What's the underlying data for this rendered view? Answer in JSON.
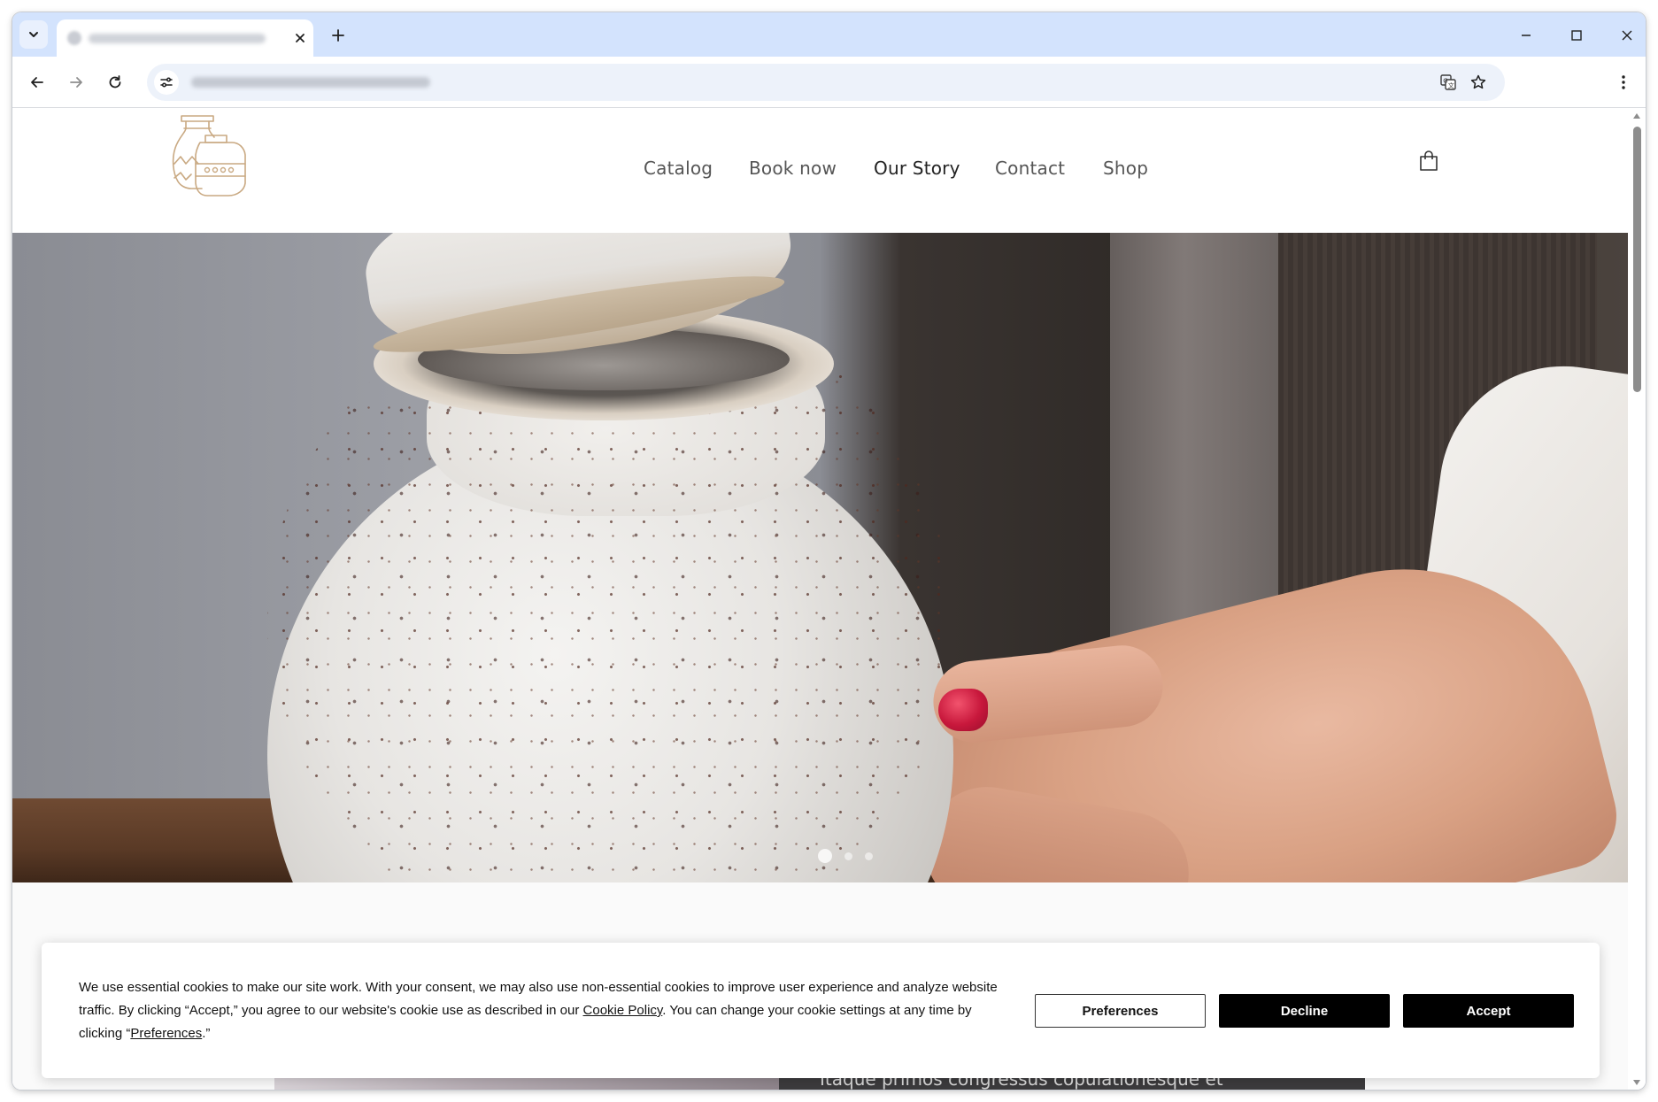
{
  "browser": {
    "tab": {
      "title": "",
      "close_icon": "close-icon"
    },
    "new_tab_icon": "plus-icon",
    "window_controls": [
      "minimize-icon",
      "maximize-icon",
      "close-icon"
    ],
    "toolbar": {
      "back_icon": "arrow-left-icon",
      "forward_icon": "arrow-right-icon",
      "reload_icon": "reload-icon",
      "site_info_icon": "tune-icon",
      "url": "",
      "translate_icon": "translate-icon",
      "bookmark_icon": "star-icon",
      "menu_icon": "kebab-menu-icon"
    }
  },
  "site": {
    "logo_icon": "vases-logo-icon",
    "nav": [
      {
        "label": "Catalog",
        "active": false
      },
      {
        "label": "Book now",
        "active": false
      },
      {
        "label": "Our Story",
        "active": true
      },
      {
        "label": "Contact",
        "active": false
      },
      {
        "label": "Shop",
        "active": false
      }
    ],
    "cart_icon": "shopping-bag-icon",
    "slideshow": {
      "slides": 3,
      "active_slide": 1
    },
    "below_text": "Itaque primos congressus copulationesque et"
  },
  "cookie_banner": {
    "text_1": "We use essential cookies to make our site work. With your consent, we may also use non-essential cookies to improve user experience and analyze website traffic. By clicking “Accept,” you agree to our website's cookie use as described in our ",
    "cookie_policy_link": "Cookie Policy",
    "text_2": ". You can change your cookie settings at any time by clicking “",
    "preferences_link": "Preferences",
    "text_3": ".”",
    "buttons": {
      "preferences": "Preferences",
      "decline": "Decline",
      "accept": "Accept"
    }
  },
  "colors": {
    "tabstrip": "#d3e3fd",
    "omnibox": "#edf2fa",
    "nav_text": "#555555",
    "nav_active": "#222222",
    "logo": "#c9a982",
    "button_dark": "#000000"
  }
}
